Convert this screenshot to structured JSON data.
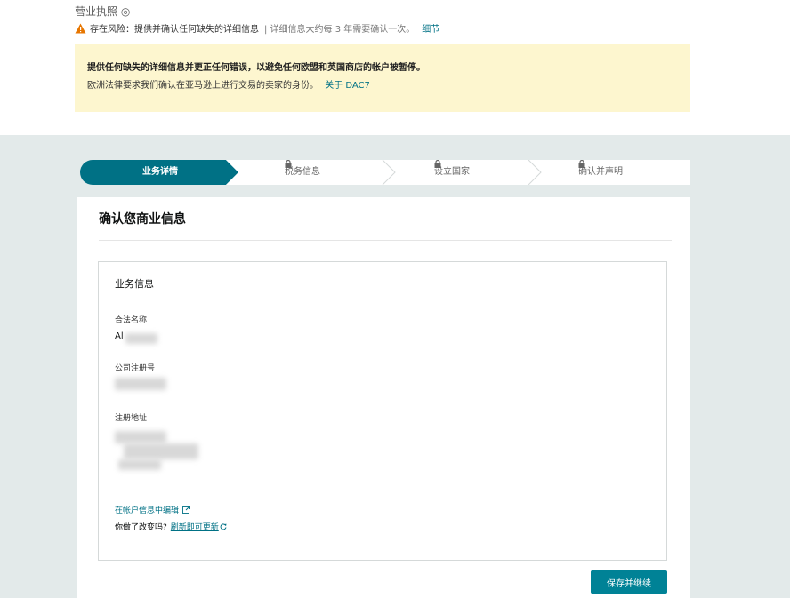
{
  "header": {
    "cut_text": "营业执照 ◎",
    "risk_label": "存在风险：提供并确认任何缺失的详细信息",
    "risk_sub": "| 详细信息大约每 3 年需要确认一次。",
    "risk_link": "细节"
  },
  "banner": {
    "title": "提供任何缺失的详细信息并更正任何错误，以避免任何欧盟和英国商店的帐户被暂停。",
    "text": "欧洲法律要求我们确认在亚马逊上进行交易的卖家的身份。",
    "link": "关于 DAC7"
  },
  "stepper": {
    "steps": [
      {
        "label": "业务详情",
        "locked": false,
        "active": true
      },
      {
        "label": "税务信息",
        "locked": true,
        "active": false
      },
      {
        "label": "设立国家",
        "locked": true,
        "active": false
      },
      {
        "label": "确认并声明",
        "locked": true,
        "active": false
      }
    ]
  },
  "card": {
    "title": "确认您商业信息",
    "section_title": "业务信息",
    "fields": [
      {
        "label": "合法名称",
        "value": "Al"
      },
      {
        "label": "公司注册号",
        "value": ""
      },
      {
        "label": "注册地址",
        "value": ""
      }
    ],
    "edit_link": "在帐户信息中编辑",
    "refresh_question": "你做了改变吗?",
    "refresh_link": "刷新即可更新",
    "save_button": "保存并继续"
  },
  "colors": {
    "accent": "#008296",
    "stepper_active": "#007185",
    "banner_bg": "#fdf6cf",
    "warning": "#e77600",
    "page_gray": "#e3eaea"
  }
}
